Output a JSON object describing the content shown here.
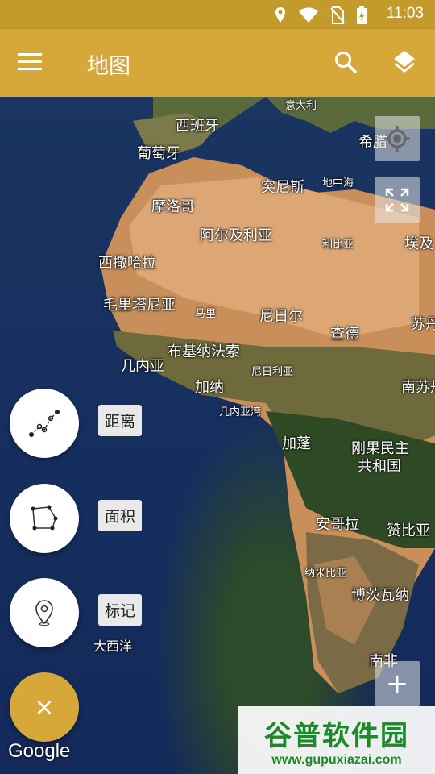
{
  "status_bar": {
    "time": "11:03",
    "icons": [
      "location-icon",
      "wifi-icon",
      "no-sim-icon",
      "battery-charging-icon"
    ]
  },
  "toolbar": {
    "title": "地图",
    "menu_icon": "menu-icon",
    "search_icon": "search-icon",
    "layers_icon": "layers-icon"
  },
  "map": {
    "places": {
      "italy": "意大利",
      "spain": "西班牙",
      "portugal": "葡萄牙",
      "greece": "希腊",
      "tunisia": "突尼斯",
      "mediterranean": "地中海",
      "morocco": "摩洛哥",
      "algeria": "阿尔及利亚",
      "libya": "利比亚",
      "egypt": "埃及",
      "western_sahara": "西撒哈拉",
      "mauritania": "毛里塔尼亚",
      "mali": "马里",
      "niger": "尼日尔",
      "chad": "查德",
      "sudan": "苏丹",
      "guinea": "几内亚",
      "burkina_faso": "布基纳法索",
      "nigeria": "尼日利亚",
      "ghana": "加纳",
      "south_sudan": "南苏丹",
      "gulf_of_guinea": "几内亚湾",
      "gabon": "加蓬",
      "drc_line1": "刚果民主",
      "drc_line2": "共和国",
      "angola": "安哥拉",
      "zambia": "赞比亚",
      "namibia": "纳米比亚",
      "botswana": "博茨瓦纳",
      "atlantic": "大西洋",
      "south_africa": "南非"
    },
    "controls": {
      "my_location_icon": "my-location-icon",
      "fullscreen_icon": "fullscreen-icon",
      "zoom_in_label": "+"
    }
  },
  "tools": [
    {
      "name": "distance",
      "label": "距离",
      "icon": "distance-path-icon"
    },
    {
      "name": "area",
      "label": "面积",
      "icon": "area-polygon-icon"
    },
    {
      "name": "marker",
      "label": "标记",
      "icon": "map-pin-icon"
    }
  ],
  "fab_close_label": "×",
  "google_logo": "Google",
  "watermark": {
    "title": "谷普软件园",
    "url": "www.gupuxiazai.com"
  }
}
